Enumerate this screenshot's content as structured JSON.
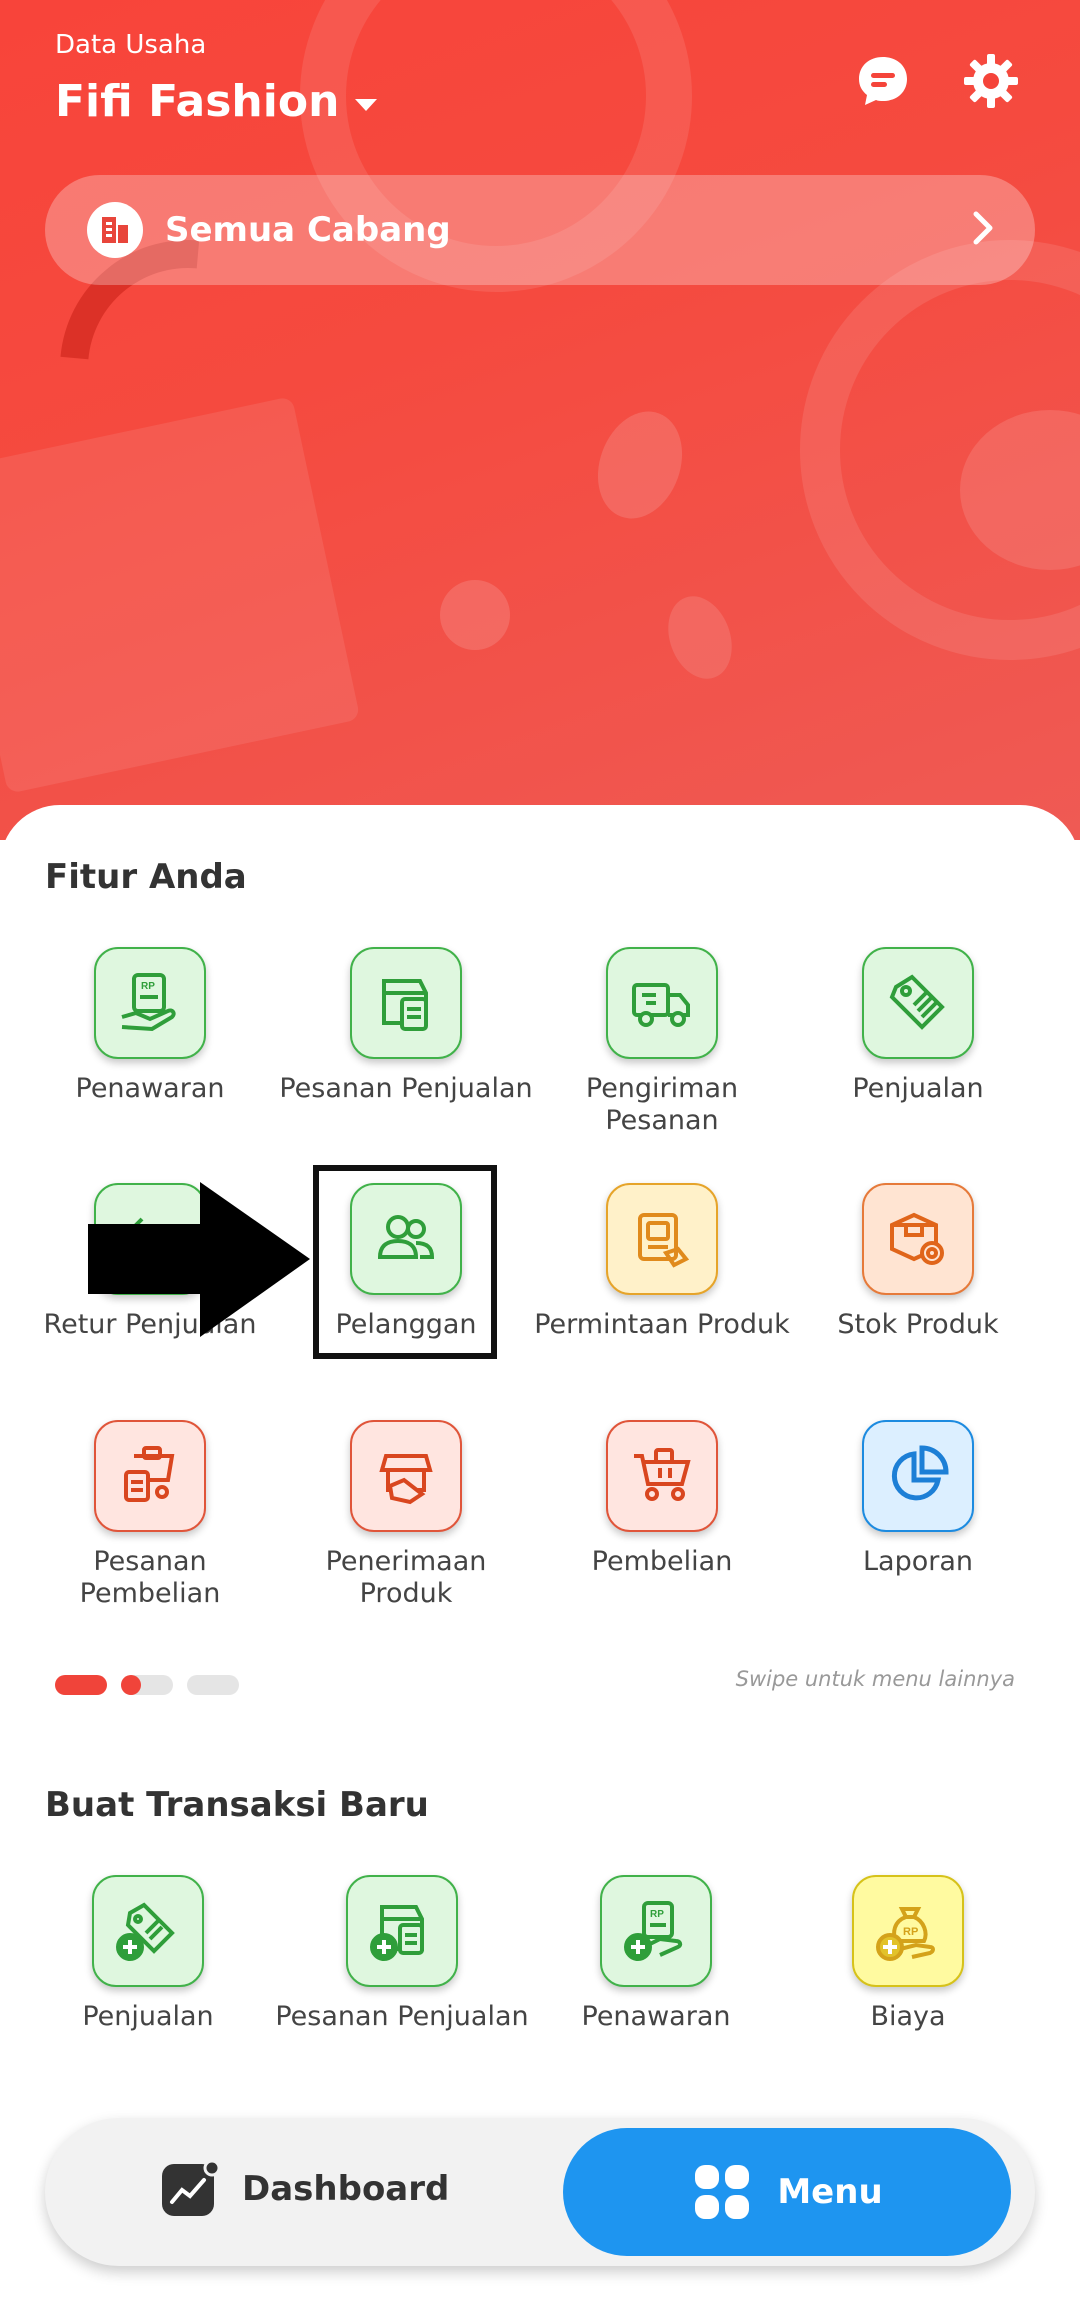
{
  "header": {
    "business_label": "Data Usaha",
    "business_name": "Fifi Fashion",
    "branch_label": "Semua Cabang"
  },
  "features": {
    "title": "Fitur Anda",
    "items": [
      {
        "label": "Penawaran",
        "icon": "quotation-icon"
      },
      {
        "label": "Pesanan Penjualan",
        "icon": "sales-order-icon"
      },
      {
        "label": "Pengiriman Pesanan",
        "icon": "delivery-truck-icon"
      },
      {
        "label": "Penjualan",
        "icon": "price-tag-icon"
      },
      {
        "label": "Retur Penjualan",
        "icon": "return-icon"
      },
      {
        "label": "Pelanggan",
        "icon": "customers-icon"
      },
      {
        "label": "Permintaan Produk",
        "icon": "product-request-icon"
      },
      {
        "label": "Stok Produk",
        "icon": "stock-box-icon"
      },
      {
        "label": "Pesanan Pembelian",
        "icon": "purchase-order-icon"
      },
      {
        "label": "Penerimaan Produk",
        "icon": "product-receipt-icon"
      },
      {
        "label": "Pembelian",
        "icon": "shopping-cart-icon"
      },
      {
        "label": "Laporan",
        "icon": "pie-chart-icon"
      }
    ],
    "swipe_hint": "Swipe untuk menu lainnya"
  },
  "new_transaction": {
    "title": "Buat Transaksi Baru",
    "items": [
      {
        "label": "Penjualan",
        "icon": "add-sale-icon"
      },
      {
        "label": "Pesanan Penjualan",
        "icon": "add-sales-order-icon"
      },
      {
        "label": "Penawaran",
        "icon": "add-quotation-icon"
      },
      {
        "label": "Biaya",
        "icon": "add-expense-icon"
      }
    ]
  },
  "bottom_nav": {
    "dashboard_label": "Dashboard",
    "menu_label": "Menu"
  },
  "colors": {
    "header_red": "#f8443a",
    "menu_blue": "#1e95f0",
    "green_icon": "#2f9e3a",
    "pager_active": "#f0443a"
  }
}
